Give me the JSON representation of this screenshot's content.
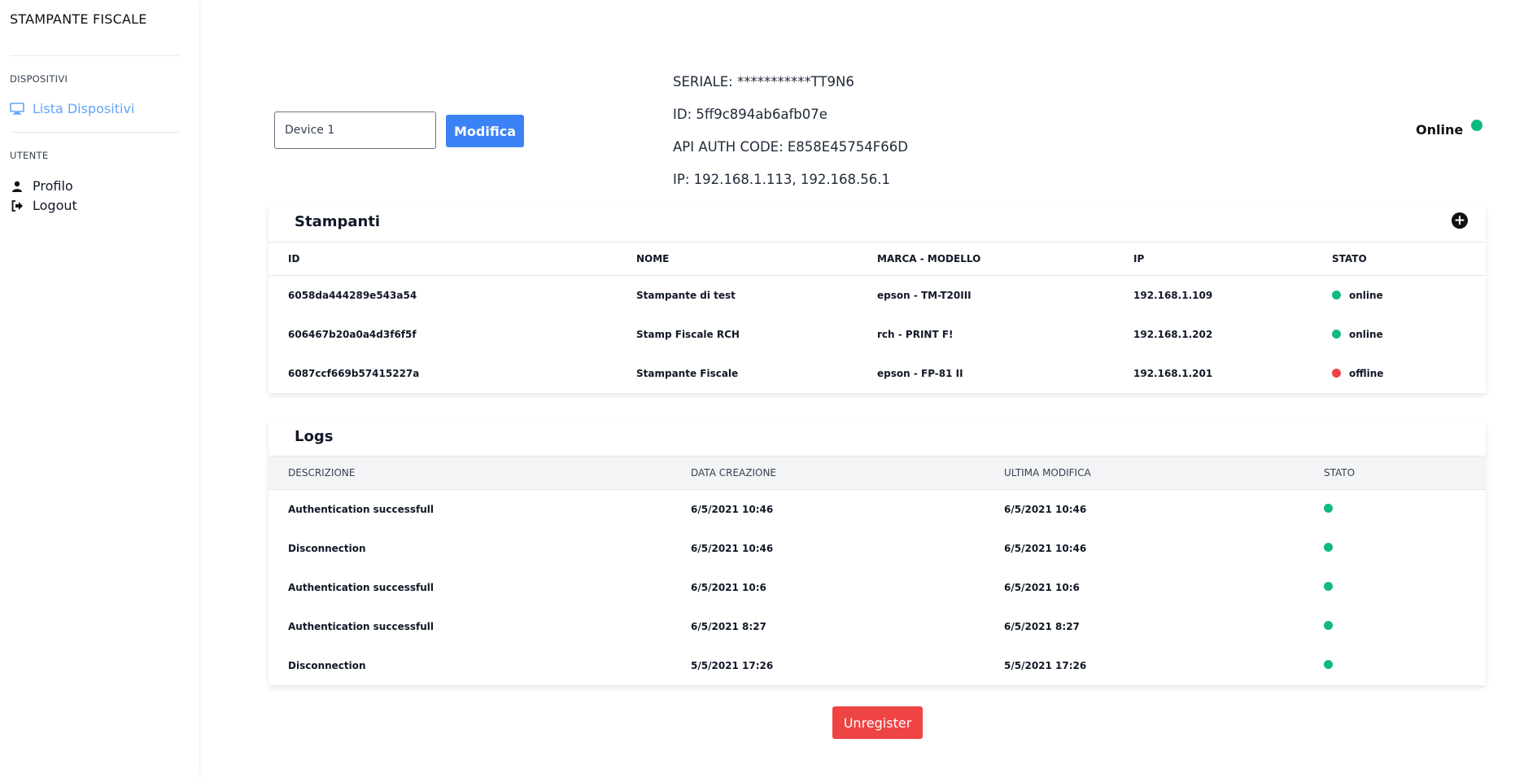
{
  "sidebar": {
    "brand": "STAMPANTE FISCALE",
    "sections": [
      {
        "title": "DISPOSITIVI",
        "items": [
          {
            "label": "Lista Dispositivi",
            "icon": "monitor-icon",
            "active": true
          }
        ]
      },
      {
        "title": "UTENTE",
        "items": [
          {
            "label": "Profilo",
            "icon": "user-icon"
          },
          {
            "label": "Logout",
            "icon": "logout-icon"
          }
        ]
      }
    ]
  },
  "device": {
    "name_value": "Device 1",
    "edit_label": "Modifica",
    "serial": "SERIALE: ***********TT9N6",
    "id": "ID: 5ff9c894ab6afb07e",
    "api_auth": "API AUTH CODE: E858E45754F66D",
    "ip": "IP: 192.168.1.113, 192.168.56.1",
    "status_label": "Online",
    "status_color": "#10b981"
  },
  "printers": {
    "title": "Stampanti",
    "add_icon": "plus-circle-icon",
    "columns": [
      "ID",
      "NOME",
      "MARCA - MODELLO",
      "IP",
      "STATO"
    ],
    "rows": [
      {
        "id": "6058da444289e543a54",
        "name": "Stampante di test",
        "model": "epson - TM-T20III",
        "ip": "192.168.1.109",
        "status": "online",
        "color": "#10b981"
      },
      {
        "id": "606467b20a0a4d3f6f5f",
        "name": "Stamp Fiscale RCH",
        "model": "rch - PRINT F!",
        "ip": "192.168.1.202",
        "status": "online",
        "color": "#10b981"
      },
      {
        "id": "6087ccf669b57415227a",
        "name": "Stampante Fiscale",
        "model": "epson - FP-81 II",
        "ip": "192.168.1.201",
        "status": "offline",
        "color": "#ef4444"
      }
    ]
  },
  "logs": {
    "title": "Logs",
    "columns": [
      "DESCRIZIONE",
      "DATA CREAZIONE",
      "ULTIMA MODIFICA",
      "STATO"
    ],
    "rows": [
      {
        "desc": "Authentication successfull",
        "created": "6/5/2021 10:46",
        "modified": "6/5/2021 10:46",
        "color": "#10b981"
      },
      {
        "desc": "Disconnection",
        "created": "6/5/2021 10:46",
        "modified": "6/5/2021 10:46",
        "color": "#10b981"
      },
      {
        "desc": "Authentication successfull",
        "created": "6/5/2021 10:6",
        "modified": "6/5/2021 10:6",
        "color": "#10b981"
      },
      {
        "desc": "Authentication successfull",
        "created": "6/5/2021 8:27",
        "modified": "6/5/2021 8:27",
        "color": "#10b981"
      },
      {
        "desc": "Disconnection",
        "created": "5/5/2021 17:26",
        "modified": "5/5/2021 17:26",
        "color": "#10b981"
      }
    ]
  },
  "actions": {
    "unregister_label": "Unregister"
  },
  "colors": {
    "accent": "#3b82f6",
    "danger": "#ef4444",
    "success": "#10b981",
    "link": "#60a5fa"
  }
}
